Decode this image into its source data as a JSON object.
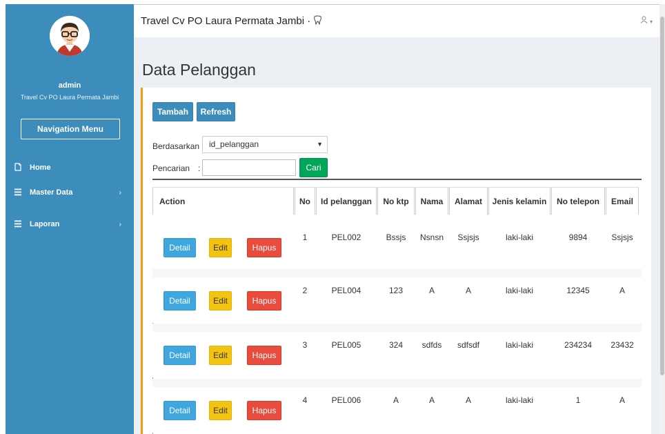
{
  "app": {
    "title": "Travel Cv PO Laura Permata Jambi",
    "title_suffix": "·",
    "user_icon": "user-icon"
  },
  "sidebar": {
    "user_name": "admin",
    "user_sub": "Travel Cv PO Laura Permata Jambi",
    "nav_header": "Navigation Menu",
    "items": [
      {
        "label": "Home",
        "icon": "home-icon",
        "has_chevron": false
      },
      {
        "label": "Master Data",
        "icon": "list-icon",
        "has_chevron": true
      },
      {
        "label": "Laporan",
        "icon": "list-icon",
        "has_chevron": true
      }
    ],
    "chevron": "›"
  },
  "page": {
    "title": "Data Pelanggan",
    "toolbar": {
      "add_label": "Tambah",
      "refresh_label": "Refresh"
    },
    "filter": {
      "by_label": "Berdasarkan :",
      "by_value": "id_pelanggan",
      "search_label": "Pencarian",
      "search_sep": ":",
      "search_value": "",
      "search_button": "Cari"
    }
  },
  "table": {
    "headers": [
      "Action",
      "No",
      "Id pelanggan",
      "No ktp",
      "Nama",
      "Alamat",
      "Jenis kelamin",
      "No telepon",
      "Email"
    ],
    "action_labels": {
      "detail": "Detail",
      "edit": "Edit",
      "delete": "Hapus"
    },
    "rows": [
      {
        "no": "1",
        "id": "PEL002",
        "ktp": "Bssjs",
        "nama": "Nsnsn",
        "alamat": "Ssjsjs",
        "jk": "laki-laki",
        "telp": "9894",
        "email": "Ssjsjs"
      },
      {
        "no": "2",
        "id": "PEL004",
        "ktp": "123",
        "nama": "A",
        "alamat": "A",
        "jk": "laki-laki",
        "telp": "12345",
        "email": "A"
      },
      {
        "no": "3",
        "id": "PEL005",
        "ktp": "324",
        "nama": "sdfds",
        "alamat": "sdfsdf",
        "jk": "laki-laki",
        "telp": "234234",
        "email": "23432"
      },
      {
        "no": "4",
        "id": "PEL006",
        "ktp": "A",
        "nama": "A",
        "alamat": "A",
        "jk": "laki-laki",
        "telp": "1",
        "email": "A"
      }
    ]
  },
  "colors": {
    "sidebar": "#3c8dbc",
    "box_accent": "#f39c12",
    "detail": "#3ea7e0",
    "edit": "#f2c40f",
    "delete": "#e74c3c",
    "search": "#00a65a"
  }
}
